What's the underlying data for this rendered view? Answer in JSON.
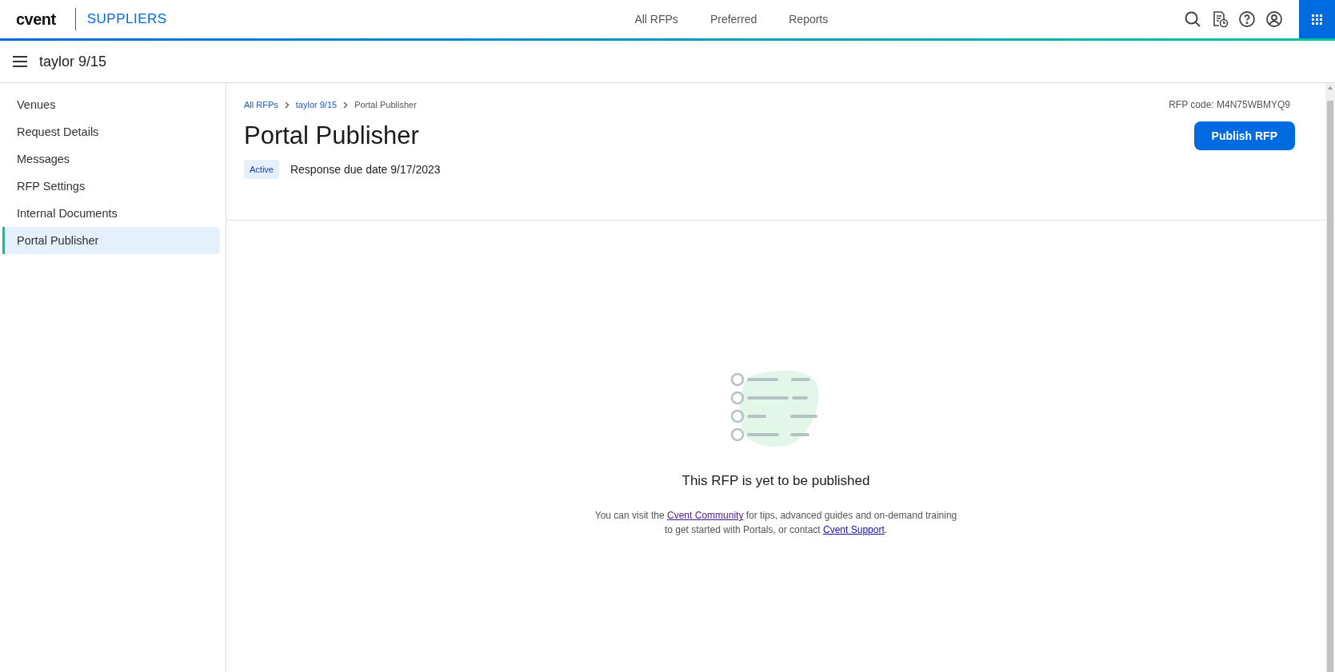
{
  "header": {
    "logo": "cvent",
    "product": "SUPPLIERS",
    "nav": [
      {
        "label": "All RFPs",
        "selected": false
      },
      {
        "label": "Preferred",
        "selected": false
      },
      {
        "label": "Reports",
        "selected": false
      }
    ]
  },
  "subheader": {
    "title": "taylor 9/15"
  },
  "sidebar": {
    "items": [
      {
        "label": "Venues",
        "selected": false
      },
      {
        "label": "Request Details",
        "selected": false
      },
      {
        "label": "Messages",
        "selected": false
      },
      {
        "label": "RFP Settings",
        "selected": false
      },
      {
        "label": "Internal Documents",
        "selected": false
      },
      {
        "label": "Portal Publisher",
        "selected": true
      }
    ]
  },
  "breadcrumb": [
    {
      "label": "All RFPs",
      "kind": "link"
    },
    {
      "label": "taylor 9/15",
      "kind": "link"
    },
    {
      "label": "Portal Publisher",
      "kind": "current"
    }
  ],
  "rfp_code": "RFP code: M4N75WBMYQ9",
  "page_title": "Portal Publisher",
  "publish_button": "Publish RFP",
  "status_badge": "Active",
  "response_due": "Response due date 9/17/2023",
  "empty_state": {
    "heading": "This RFP is yet to be published",
    "message": [
      {
        "kind": "text",
        "text": "You can visit the "
      },
      {
        "kind": "link",
        "text": "Cvent Community"
      },
      {
        "kind": "text",
        "text": " for tips, advanced guides and on-demand training to get started with Portals, or contact "
      },
      {
        "kind": "link",
        "text": "Cvent Support"
      },
      {
        "kind": "text",
        "text": "."
      }
    ]
  }
}
